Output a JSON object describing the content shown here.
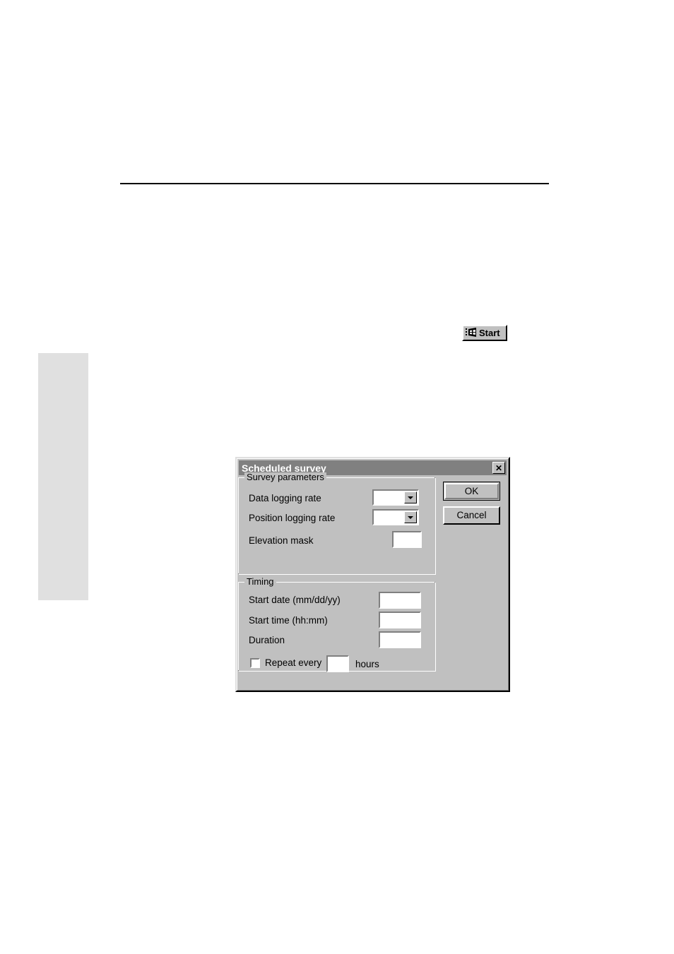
{
  "page": {
    "background_color": "#ffffff",
    "rule": {
      "present": true
    },
    "margin_callout": {
      "present": true,
      "color": "#e0e0e0"
    }
  },
  "start_button": {
    "label": "Start",
    "icon": "windows-flag-icon"
  },
  "dialog": {
    "title": "Scheduled survey",
    "close_button_glyph": "✕",
    "face_color": "#c0c0c0",
    "titlebar_color": "#808080",
    "groups": {
      "survey_parameters": {
        "title": "Survey parameters",
        "fields": [
          {
            "label": "Data logging rate",
            "type": "combobox",
            "value": ""
          },
          {
            "label": "Position logging rate",
            "type": "combobox",
            "value": ""
          },
          {
            "label": "Elevation mask",
            "type": "textbox",
            "value": ""
          }
        ]
      },
      "timing": {
        "title": "Timing",
        "fields": [
          {
            "label": "Start date (mm/dd/yy)",
            "type": "textbox",
            "value": ""
          },
          {
            "label": "Start time (hh:mm)",
            "type": "textbox",
            "value": ""
          },
          {
            "label": "Duration",
            "type": "textbox",
            "value": ""
          }
        ],
        "repeat": {
          "checkbox_label": "Repeat every",
          "checked": false,
          "value": "",
          "units_label": "hours"
        }
      }
    },
    "buttons": {
      "ok": "OK",
      "cancel": "Cancel"
    }
  }
}
